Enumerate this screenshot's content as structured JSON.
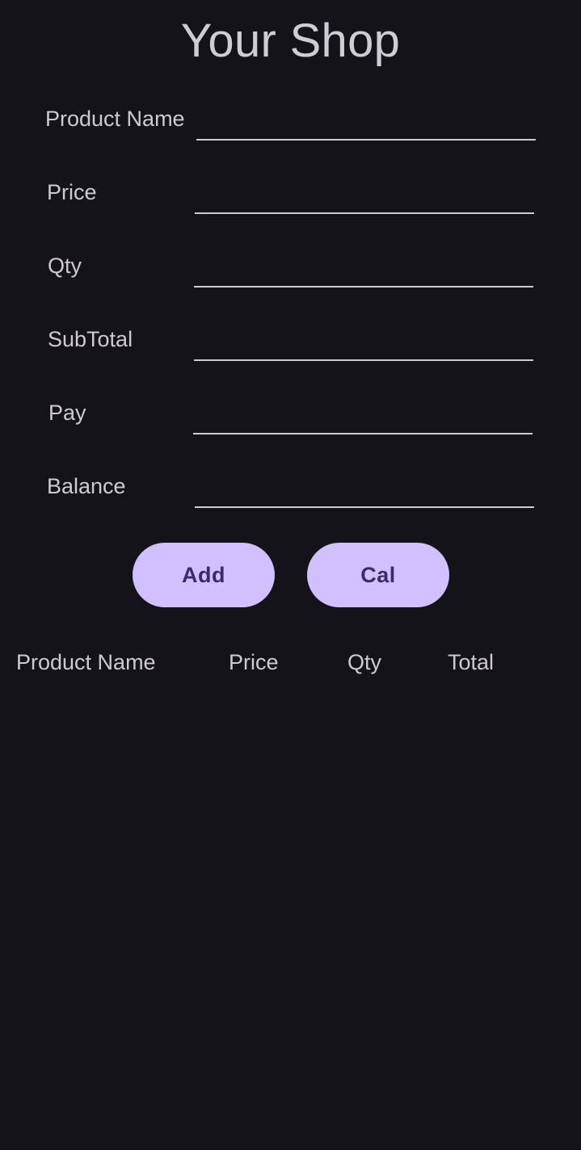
{
  "app": {
    "title": "Your Shop"
  },
  "form": {
    "product_name_label": "Product Name",
    "price_label": "Price",
    "qty_label": "Qty",
    "subtotal_label": "SubTotal",
    "pay_label": "Pay",
    "balance_label": "Balance",
    "product_name_value": "",
    "price_value": "",
    "qty_value": "",
    "subtotal_value": "",
    "pay_value": "",
    "balance_value": ""
  },
  "buttons": {
    "add_label": "Add",
    "cal_label": "Cal"
  },
  "table": {
    "columns": [
      "Product Name",
      "Price",
      "Qty",
      "Total"
    ],
    "rows": []
  },
  "colors": {
    "background": "#15131a",
    "button_bg": "#d2bffd",
    "button_text": "#3b2a6b",
    "text": "#cfc9d3"
  }
}
